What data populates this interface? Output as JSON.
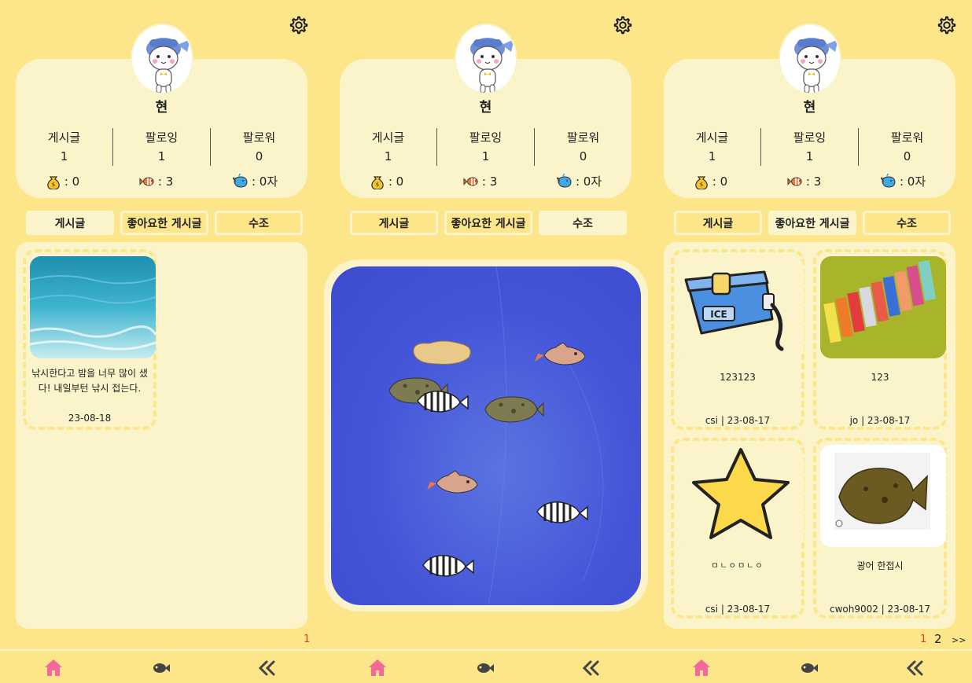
{
  "profile": {
    "username": "현",
    "stats": [
      {
        "label": "게시글",
        "value": "1"
      },
      {
        "label": "팔로잉",
        "value": "1"
      },
      {
        "label": "팔로워",
        "value": "0"
      }
    ],
    "coins": ": 0",
    "fish": ": 3",
    "size": ": 0자"
  },
  "tabs": [
    "게시글",
    "좋아요한 게시글",
    "수조"
  ],
  "panel1": {
    "posts": [
      {
        "text": "낚시한다고 밤을 너무 많이 샜다! 내일부턴 낚시 접는다.",
        "date": "23-08-18"
      }
    ],
    "page": "1"
  },
  "panel3": {
    "posts": [
      {
        "title": "123123",
        "meta": "csi | 23-08-17"
      },
      {
        "title": "123",
        "meta": "jo | 23-08-17"
      },
      {
        "title": "ㅁㄴㅇㅁㄴㅇ",
        "meta": "csi | 23-08-17"
      },
      {
        "title": "광어 한접시",
        "meta": "cwoh9002 | 23-08-17"
      }
    ],
    "pages": [
      "1",
      "2"
    ],
    "next": ">>"
  },
  "colors": {
    "background": "#fde68a",
    "card": "#fbf3c9",
    "accent": "#f2699a",
    "page_active": "#e53935"
  },
  "icons": {
    "settings": "gear-icon",
    "home": "home-icon",
    "fish_nav": "fish-icon",
    "back": "double-chevron-left-icon"
  }
}
